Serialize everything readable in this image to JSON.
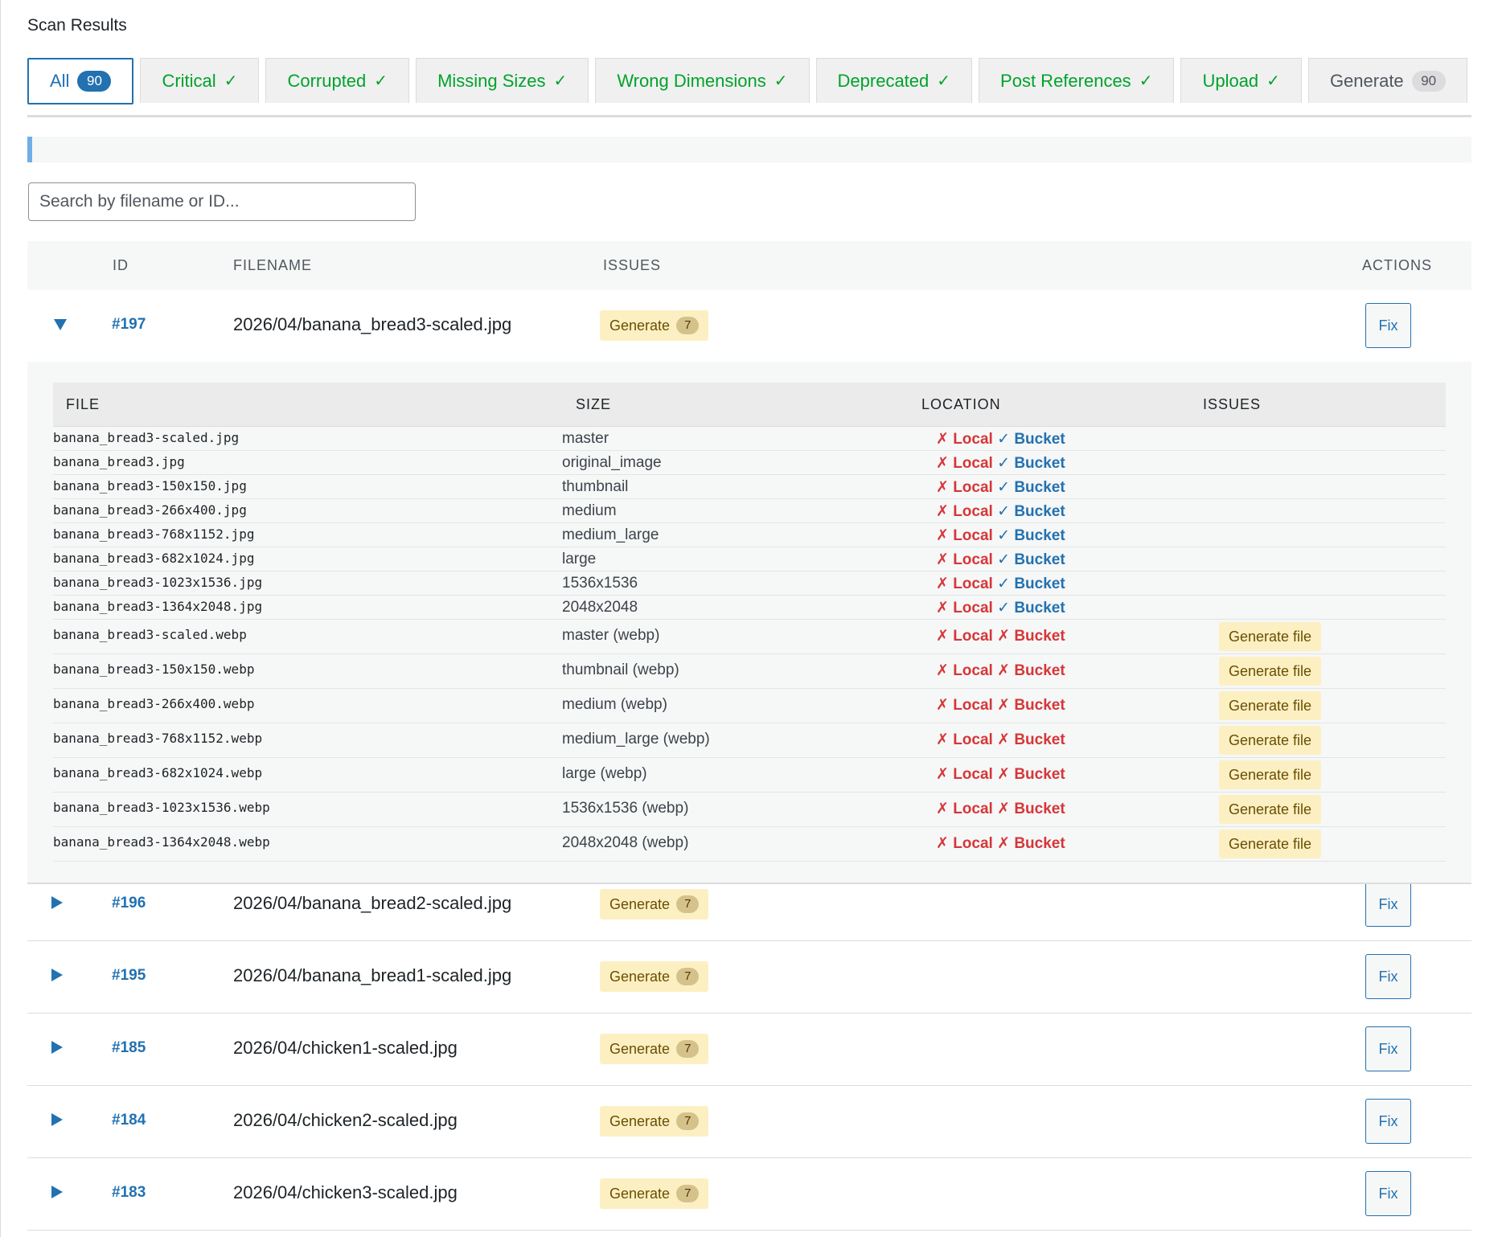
{
  "title": "Scan Results",
  "tabs": [
    {
      "label": "All",
      "count": "90",
      "state": "active"
    },
    {
      "label": "Critical",
      "mark": "✓",
      "state": "done"
    },
    {
      "label": "Corrupted",
      "mark": "✓",
      "state": "done"
    },
    {
      "label": "Missing Sizes",
      "mark": "✓",
      "state": "done"
    },
    {
      "label": "Wrong Dimensions",
      "mark": "✓",
      "state": "done"
    },
    {
      "label": "Deprecated",
      "mark": "✓",
      "state": "done"
    },
    {
      "label": "Post References",
      "mark": "✓",
      "state": "done"
    },
    {
      "label": "Upload",
      "mark": "✓",
      "state": "done"
    },
    {
      "label": "Generate",
      "count": "90",
      "state": "plain"
    }
  ],
  "progress": {
    "fraction": 0
  },
  "search": {
    "placeholder": "Search by filename or ID..."
  },
  "columns": {
    "id": "ID",
    "filename": "FILENAME",
    "issues": "ISSUES",
    "actions": "ACTIONS"
  },
  "rows": [
    {
      "id": "#197",
      "filename": "2026/04/banana_bread3-scaled.jpg",
      "issue_label": "Generate",
      "issue_count": "7",
      "action": "Fix",
      "expanded": true
    },
    {
      "id": "#196",
      "filename": "2026/04/banana_bread2-scaled.jpg",
      "issue_label": "Generate",
      "issue_count": "7",
      "action": "Fix",
      "expanded": false
    },
    {
      "id": "#195",
      "filename": "2026/04/banana_bread1-scaled.jpg",
      "issue_label": "Generate",
      "issue_count": "7",
      "action": "Fix",
      "expanded": false
    },
    {
      "id": "#185",
      "filename": "2026/04/chicken1-scaled.jpg",
      "issue_label": "Generate",
      "issue_count": "7",
      "action": "Fix",
      "expanded": false
    },
    {
      "id": "#184",
      "filename": "2026/04/chicken2-scaled.jpg",
      "issue_label": "Generate",
      "issue_count": "7",
      "action": "Fix",
      "expanded": false
    },
    {
      "id": "#183",
      "filename": "2026/04/chicken3-scaled.jpg",
      "issue_label": "Generate",
      "issue_count": "7",
      "action": "Fix",
      "expanded": false
    }
  ],
  "detail": {
    "columns": {
      "file": "FILE",
      "size": "SIZE",
      "location": "LOCATION",
      "issues": "ISSUES"
    },
    "local_label": "Local",
    "bucket_label": "Bucket",
    "files": [
      {
        "file": "banana_bread3-scaled.jpg",
        "size": "master",
        "local": false,
        "bucket": true,
        "issue": ""
      },
      {
        "file": "banana_bread3.jpg",
        "size": "original_image",
        "local": false,
        "bucket": true,
        "issue": ""
      },
      {
        "file": "banana_bread3-150x150.jpg",
        "size": "thumbnail",
        "local": false,
        "bucket": true,
        "issue": ""
      },
      {
        "file": "banana_bread3-266x400.jpg",
        "size": "medium",
        "local": false,
        "bucket": true,
        "issue": ""
      },
      {
        "file": "banana_bread3-768x1152.jpg",
        "size": "medium_large",
        "local": false,
        "bucket": true,
        "issue": ""
      },
      {
        "file": "banana_bread3-682x1024.jpg",
        "size": "large",
        "local": false,
        "bucket": true,
        "issue": ""
      },
      {
        "file": "banana_bread3-1023x1536.jpg",
        "size": "1536x1536",
        "local": false,
        "bucket": true,
        "issue": ""
      },
      {
        "file": "banana_bread3-1364x2048.jpg",
        "size": "2048x2048",
        "local": false,
        "bucket": true,
        "issue": ""
      },
      {
        "file": "banana_bread3-scaled.webp",
        "size": "master (webp)",
        "local": false,
        "bucket": false,
        "issue": "Generate file"
      },
      {
        "file": "banana_bread3-150x150.webp",
        "size": "thumbnail (webp)",
        "local": false,
        "bucket": false,
        "issue": "Generate file"
      },
      {
        "file": "banana_bread3-266x400.webp",
        "size": "medium (webp)",
        "local": false,
        "bucket": false,
        "issue": "Generate file"
      },
      {
        "file": "banana_bread3-768x1152.webp",
        "size": "medium_large (webp)",
        "local": false,
        "bucket": false,
        "issue": "Generate file"
      },
      {
        "file": "banana_bread3-682x1024.webp",
        "size": "large (webp)",
        "local": false,
        "bucket": false,
        "issue": "Generate file"
      },
      {
        "file": "banana_bread3-1023x1536.webp",
        "size": "1536x1536 (webp)",
        "local": false,
        "bucket": false,
        "issue": "Generate file"
      },
      {
        "file": "banana_bread3-1364x2048.webp",
        "size": "2048x2048 (webp)",
        "local": false,
        "bucket": false,
        "issue": "Generate file"
      }
    ]
  },
  "colors": {
    "accent": "#2271b1",
    "success": "#00a32a",
    "error": "#d63638",
    "warning_bg": "#fcf0c3"
  }
}
